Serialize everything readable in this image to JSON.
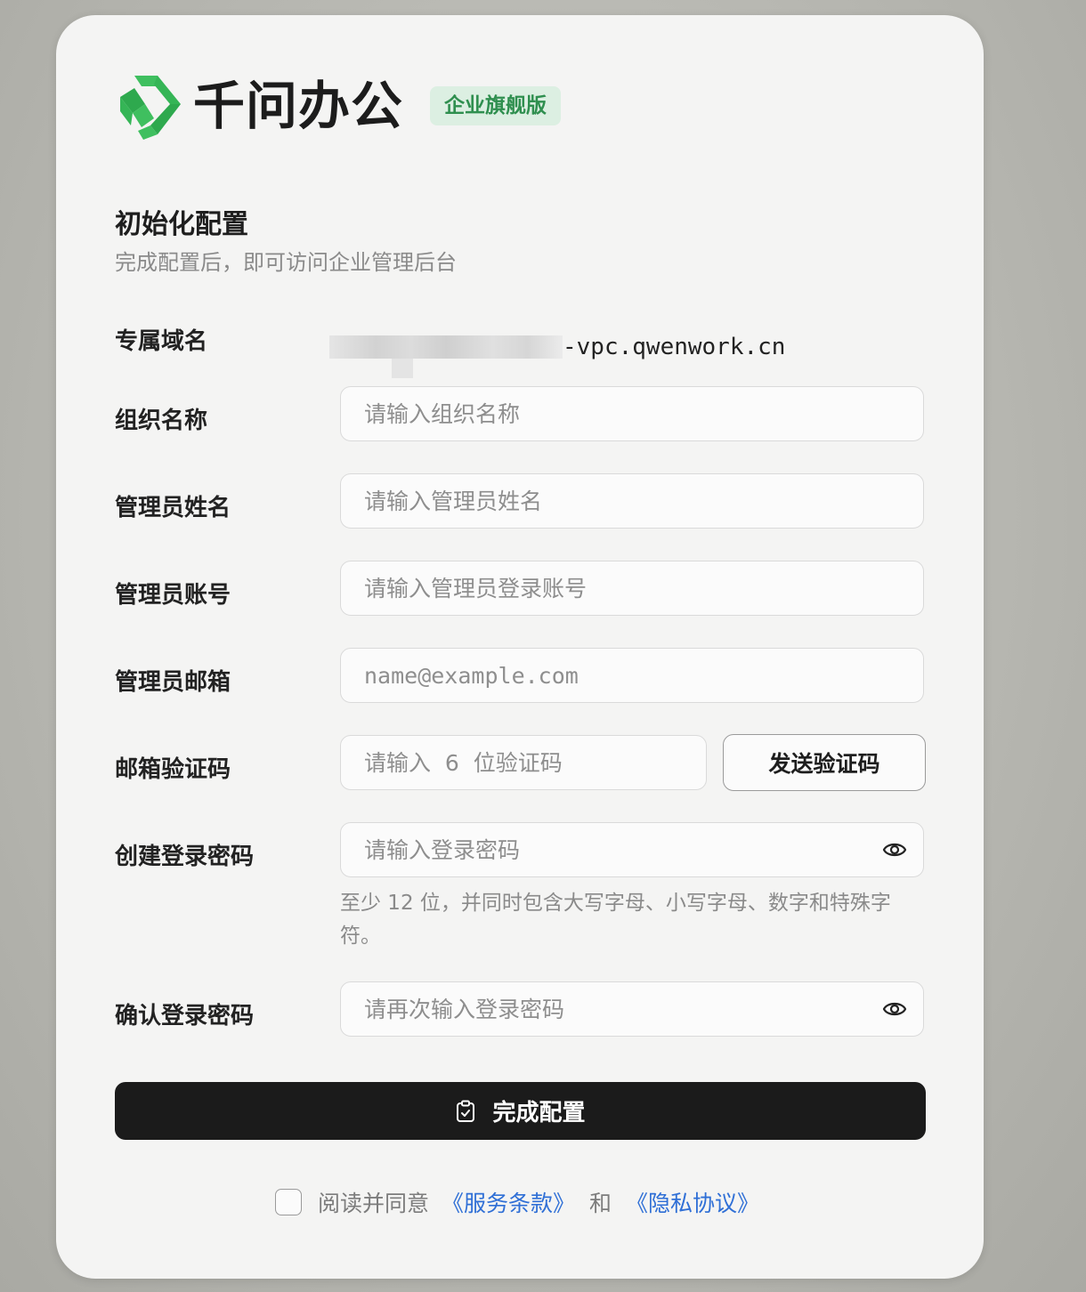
{
  "brand": {
    "name": "千问办公",
    "edition": "企业旗舰版",
    "logo_icon": "qwen-work-logo-icon",
    "logo_colors": [
      "#3fbf5f",
      "#2ea94e"
    ]
  },
  "setup": {
    "title": "初始化配置",
    "subtitle": "完成配置后，即可访问企业管理后台"
  },
  "domain": {
    "label": "专属域名",
    "suffix": "-vpc.qwenwork.cn"
  },
  "fields": {
    "org_name": {
      "label": "组织名称",
      "placeholder": "请输入组织名称"
    },
    "admin_name": {
      "label": "管理员姓名",
      "placeholder": "请输入管理员姓名"
    },
    "admin_account": {
      "label": "管理员账号",
      "placeholder": "请输入管理员登录账号"
    },
    "admin_email": {
      "label": "管理员邮箱",
      "placeholder": "name@example.com"
    },
    "email_code": {
      "label": "邮箱验证码",
      "placeholder": "请输入  6  位验证码",
      "send_button": "发送验证码"
    },
    "password": {
      "label": "创建登录密码",
      "placeholder": "请输入登录密码",
      "hint": "至少  12  位，并同时包含大写字母、小写字母、数字和特殊字符。",
      "toggle_icon": "eye-icon"
    },
    "confirm_password": {
      "label": "确认登录密码",
      "placeholder": "请再次输入登录密码",
      "toggle_icon": "eye-icon"
    }
  },
  "submit": {
    "label": "完成配置",
    "icon": "clipboard-check-icon"
  },
  "agreement": {
    "prefix": "阅读并同意",
    "terms": "《服务条款》",
    "and": "和",
    "privacy": "《隐私协议》",
    "link_color": "#2f6fd6"
  }
}
